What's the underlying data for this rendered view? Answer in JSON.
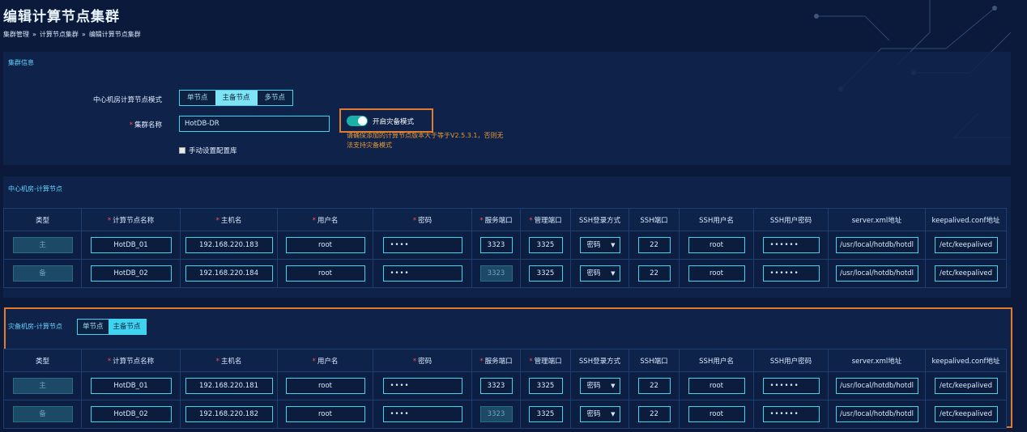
{
  "page": {
    "title": "编辑计算节点集群"
  },
  "breadcrumb": {
    "items": [
      "集群管理",
      "计算节点集群",
      "编辑计算节点集群"
    ],
    "sep": "»"
  },
  "cluster": {
    "section_title": "集群信息",
    "mode_label": "中心机房计算节点模式",
    "mode_options": [
      "单节点",
      "主备节点",
      "多节点"
    ],
    "mode_selected": "主备节点",
    "name_label": "集群名称",
    "name_value": "HotDB-DR",
    "manual_config_label": "手动设置配置库",
    "dr_toggle_label": "开启灾备模式",
    "dr_toggle_on": true,
    "dr_warning": "请确保添加的计算节点版本大于等于V2.5.3.1，否则无法支持灾备模式"
  },
  "columns": [
    "类型",
    "计算节点名称",
    "主机名",
    "用户名",
    "密码",
    "服务端口",
    "管理端口",
    "SSH登录方式",
    "SSH端口",
    "SSH用户名",
    "SSH用户密码",
    "server.xml地址",
    "keepalived.conf地址"
  ],
  "required_cols": [
    1,
    2,
    3,
    4,
    5,
    6
  ],
  "center": {
    "section_title": "中心机房-计算节点",
    "rows": [
      {
        "type": "主",
        "name": "HotDB_01",
        "host": "192.168.220.183",
        "user": "root",
        "pwd": "••••",
        "port": "3323",
        "mgr_port": "3325",
        "ssh_mode": "密码",
        "ssh_port": "22",
        "ssh_user": "root",
        "ssh_pwd": "••••••",
        "server_xml": "/usr/local/hotdb/hotdl",
        "keepalived": "/etc/keepalived",
        "port_disabled": false
      },
      {
        "type": "备",
        "name": "HotDB_02",
        "host": "192.168.220.184",
        "user": "root",
        "pwd": "••••",
        "port": "3323",
        "mgr_port": "3325",
        "ssh_mode": "密码",
        "ssh_port": "22",
        "ssh_user": "root",
        "ssh_pwd": "••••••",
        "server_xml": "/usr/local/hotdb/hotdl",
        "keepalived": "/etc/keepalived",
        "port_disabled": true
      }
    ]
  },
  "dr": {
    "section_title": "灾备机房-计算节点",
    "mode_options": [
      "单节点",
      "主备节点"
    ],
    "mode_selected": "主备节点",
    "rows": [
      {
        "type": "主",
        "name": "HotDB_01",
        "host": "192.168.220.181",
        "user": "root",
        "pwd": "••••",
        "port": "3323",
        "mgr_port": "3325",
        "ssh_mode": "密码",
        "ssh_port": "22",
        "ssh_user": "root",
        "ssh_pwd": "••••••",
        "server_xml": "/usr/local/hotdb/hotdl",
        "keepalived": "/etc/keepalived",
        "port_disabled": false
      },
      {
        "type": "备",
        "name": "HotDB_02",
        "host": "192.168.220.182",
        "user": "root",
        "pwd": "••••",
        "port": "3323",
        "mgr_port": "3325",
        "ssh_mode": "密码",
        "ssh_port": "22",
        "ssh_user": "root",
        "ssh_pwd": "••••••",
        "server_xml": "/usr/local/hotdb/hotdl",
        "keepalived": "/etc/keepalived",
        "port_disabled": true
      }
    ]
  },
  "colors": {
    "accent": "#3ed4ef",
    "highlight": "#e07a2e",
    "required": "#ff4d4f",
    "warning": "#e39a3c"
  }
}
